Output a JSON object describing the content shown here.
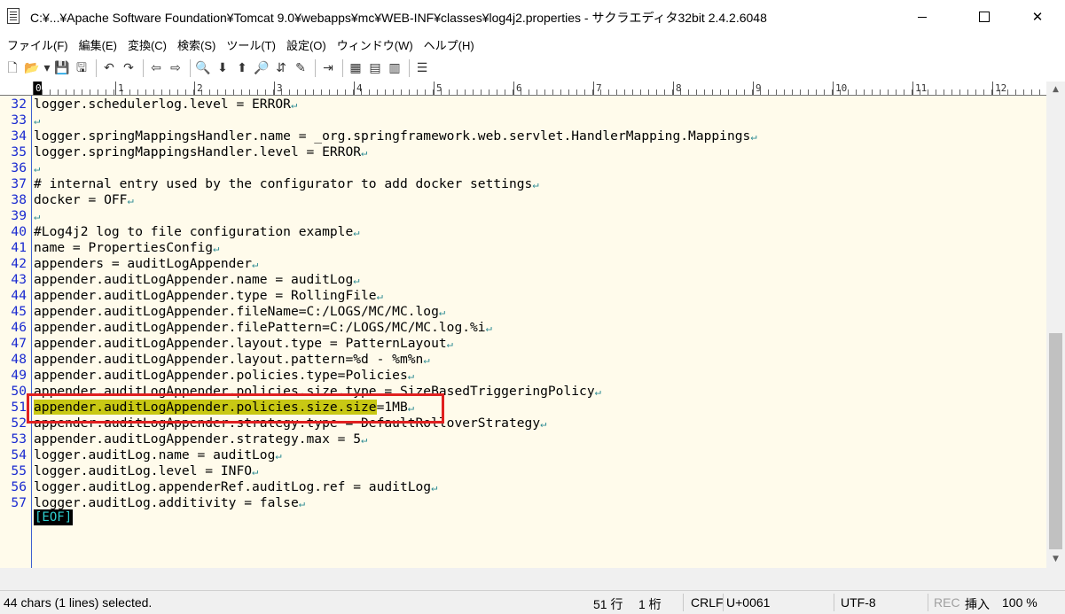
{
  "window": {
    "title": "C:¥...¥Apache Software Foundation¥Tomcat 9.0¥webapps¥mc¥WEB-INF¥classes¥log4j2.properties - サクラエディタ32bit 2.4.2.6048",
    "minimize": "minimize-icon",
    "maximize": "maximize-icon",
    "close": "✕"
  },
  "menu": [
    "ファイル(F)",
    "編集(E)",
    "変換(C)",
    "検索(S)",
    "ツール(T)",
    "設定(O)",
    "ウィンドウ(W)",
    "ヘルプ(H)"
  ],
  "toolbar": {
    "new": "🗋",
    "open": "📂",
    "open_dd": "▾",
    "save": "💾",
    "save_all": "🖫",
    "undo": "↶",
    "redo": "↷",
    "back": "⇦",
    "forward": "⇨",
    "find1": "🔍",
    "find2": "⬇",
    "find3": "⬆",
    "find4": "🔎",
    "find5": "⇵",
    "find6": "✎",
    "jump": "⇥",
    "compare1": "▦",
    "compare2": "▤",
    "compare3": "▥",
    "outline": "☰"
  },
  "ruler": {
    "labels": [
      "0",
      "1",
      "2",
      "3",
      "4",
      "5",
      "6",
      "7",
      "8",
      "9",
      "10",
      "11",
      "12"
    ]
  },
  "editor": {
    "lines": [
      {
        "num": "32",
        "text": "logger.schedulerlog.level = ERROR",
        "eol": "↵"
      },
      {
        "num": "33",
        "text": "",
        "eol": "↵"
      },
      {
        "num": "34",
        "text": "logger.springMappingsHandler.name = _org.springframework.web.servlet.HandlerMapping.Mappings",
        "eol": "↵"
      },
      {
        "num": "35",
        "text": "logger.springMappingsHandler.level = ERROR",
        "eol": "↵"
      },
      {
        "num": "36",
        "text": "",
        "eol": "↵"
      },
      {
        "num": "37",
        "text": "# internal entry used by the configurator to add docker settings",
        "eol": "↵"
      },
      {
        "num": "38",
        "text": "docker = OFF",
        "eol": "↵"
      },
      {
        "num": "39",
        "text": "",
        "eol": "↵"
      },
      {
        "num": "40",
        "text": "#Log4j2 log to file configuration example",
        "eol": "↵"
      },
      {
        "num": "41",
        "text": "name = PropertiesConfig",
        "eol": "↵"
      },
      {
        "num": "42",
        "text": "appenders = auditLogAppender",
        "eol": "↵"
      },
      {
        "num": "43",
        "text": "appender.auditLogAppender.name = auditLog",
        "eol": "↵"
      },
      {
        "num": "44",
        "text": "appender.auditLogAppender.type = RollingFile",
        "eol": "↵"
      },
      {
        "num": "45",
        "text": "appender.auditLogAppender.fileName=C:/LOGS/MC/MC.log",
        "eol": "↵"
      },
      {
        "num": "46",
        "text": "appender.auditLogAppender.filePattern=C:/LOGS/MC/MC.log.%i",
        "eol": "↵"
      },
      {
        "num": "47",
        "text": "appender.auditLogAppender.layout.type = PatternLayout",
        "eol": "↵"
      },
      {
        "num": "48",
        "text": "appender.auditLogAppender.layout.pattern=%d - %m%n",
        "eol": "↵"
      },
      {
        "num": "49",
        "text": "appender.auditLogAppender.policies.type=Policies",
        "eol": "↵"
      },
      {
        "num": "50",
        "text": "appender.auditLogAppender.policies.size.type = SizeBasedTriggeringPolicy",
        "eol": "↵"
      },
      {
        "num": "51",
        "selected": "appender.auditLogAppender.policies.size.size",
        "text": "=1MB",
        "eol": "↵"
      },
      {
        "num": "52",
        "text": "appender.auditLogAppender.strategy.type = DefaultRolloverStrategy",
        "eol": "↵"
      },
      {
        "num": "53",
        "text": "appender.auditLogAppender.strategy.max = 5",
        "eol": "↵"
      },
      {
        "num": "54",
        "text": "logger.auditLog.name = auditLog",
        "eol": "↵"
      },
      {
        "num": "55",
        "text": "logger.auditLog.level = INFO",
        "eol": "↵"
      },
      {
        "num": "56",
        "text": "logger.auditLog.appenderRef.auditLog.ref = auditLog",
        "eol": "↵"
      },
      {
        "num": "57",
        "text": "logger.auditLog.additivity = false",
        "eol": "↵"
      }
    ],
    "eof": "[EOF]"
  },
  "scrollbar": {
    "up": "▲",
    "down": "▼"
  },
  "status": {
    "selection": "44 chars (1 lines) selected.",
    "line": "51 行",
    "column": "1 桁",
    "newline": "CRLF",
    "codepoint": "U+0061",
    "encoding": "UTF-8",
    "rec": "REC",
    "insert_mode": "挿入",
    "zoom": "100 %"
  }
}
